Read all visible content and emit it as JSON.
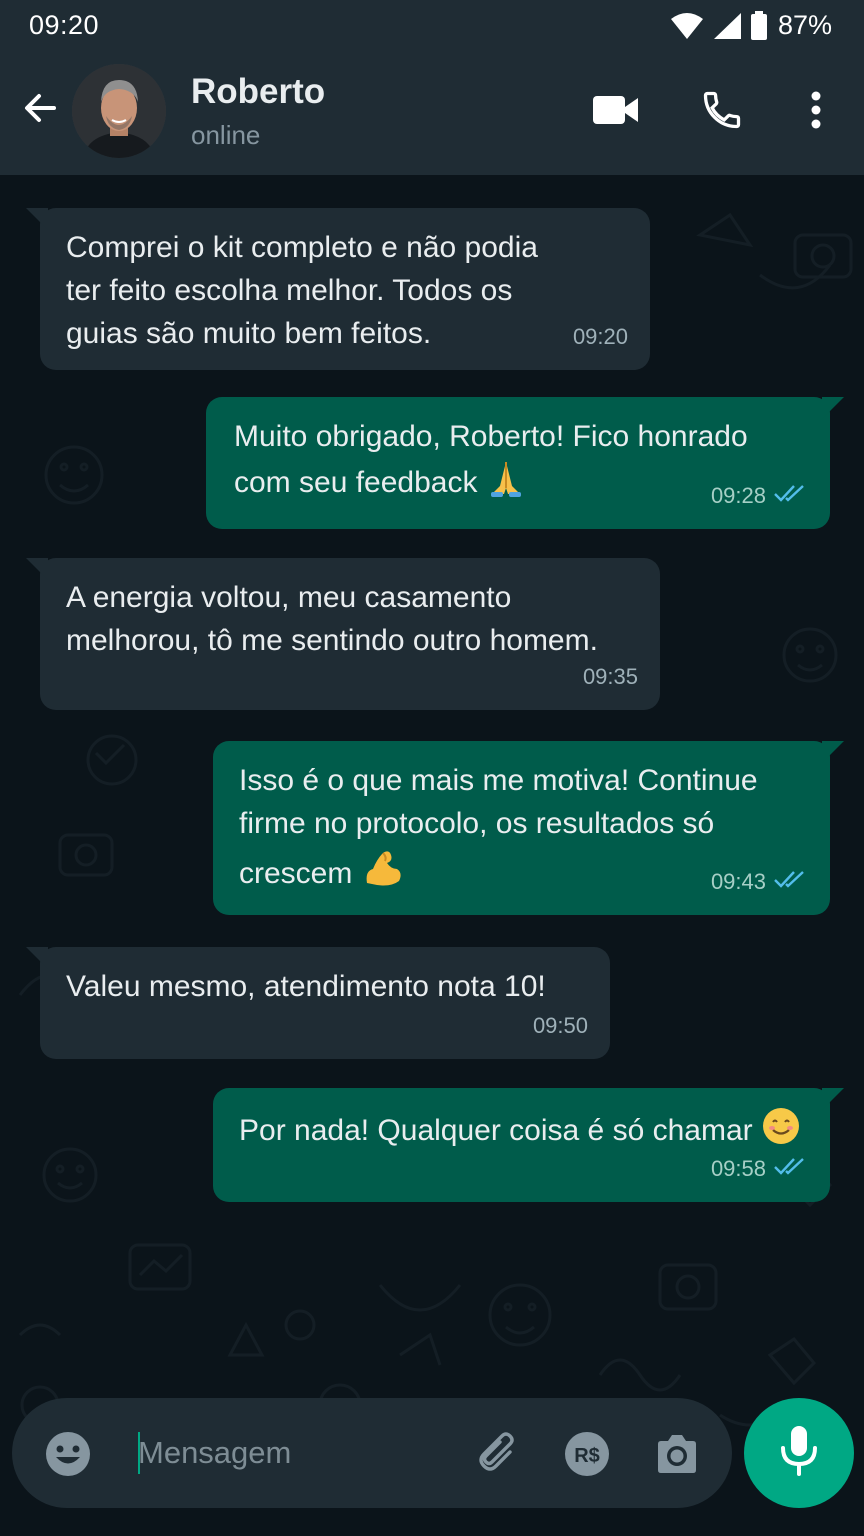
{
  "status_bar": {
    "time": "09:20",
    "battery": "87%"
  },
  "contact": {
    "name": "Roberto",
    "status": "online"
  },
  "icons": {
    "back": "arrow-left-icon",
    "video": "video-camera-icon",
    "call": "phone-icon",
    "menu": "more-vertical-icon",
    "emoji": "smiley-icon",
    "attach": "paperclip-icon",
    "payment": "brazil-real-icon",
    "camera": "camera-icon",
    "mic": "microphone-icon",
    "read": "double-check-icon"
  },
  "colors": {
    "header": "#1f2c34",
    "background": "#0b141a",
    "incoming": "#1f2c34",
    "outgoing": "#005c4b",
    "accent": "#00a884",
    "read_ticks": "#53bdeb"
  },
  "messages": [
    {
      "direction": "in",
      "lines": [
        "Comprei o kit completo e não podia",
        "ter feito escolha melhor. Todos os",
        "guias são muito bem feitos."
      ],
      "time": "09:20"
    },
    {
      "direction": "out",
      "lines": [
        "Muito obrigado, Roberto! Fico honrado",
        "com seu feedback"
      ],
      "emoji": "🙏",
      "time": "09:28",
      "read": true
    },
    {
      "direction": "in",
      "lines": [
        "A energia voltou, meu casamento",
        "melhorou, tô me sentindo outro homem."
      ],
      "time": "09:35"
    },
    {
      "direction": "out",
      "lines": [
        "Isso é o que mais me motiva! Continue",
        "firme no protocolo, os resultados só",
        "crescem"
      ],
      "emoji": "💪",
      "time": "09:43",
      "read": true
    },
    {
      "direction": "in",
      "lines": [
        "Valeu mesmo, atendimento nota 10!"
      ],
      "time": "09:50"
    },
    {
      "direction": "out",
      "lines": [
        "Por nada! Qualquer coisa é só chamar"
      ],
      "emoji": "😊",
      "time": "09:58",
      "read": true
    }
  ],
  "composer": {
    "placeholder": "Mensagem",
    "value": "",
    "payment_label": "R$"
  }
}
